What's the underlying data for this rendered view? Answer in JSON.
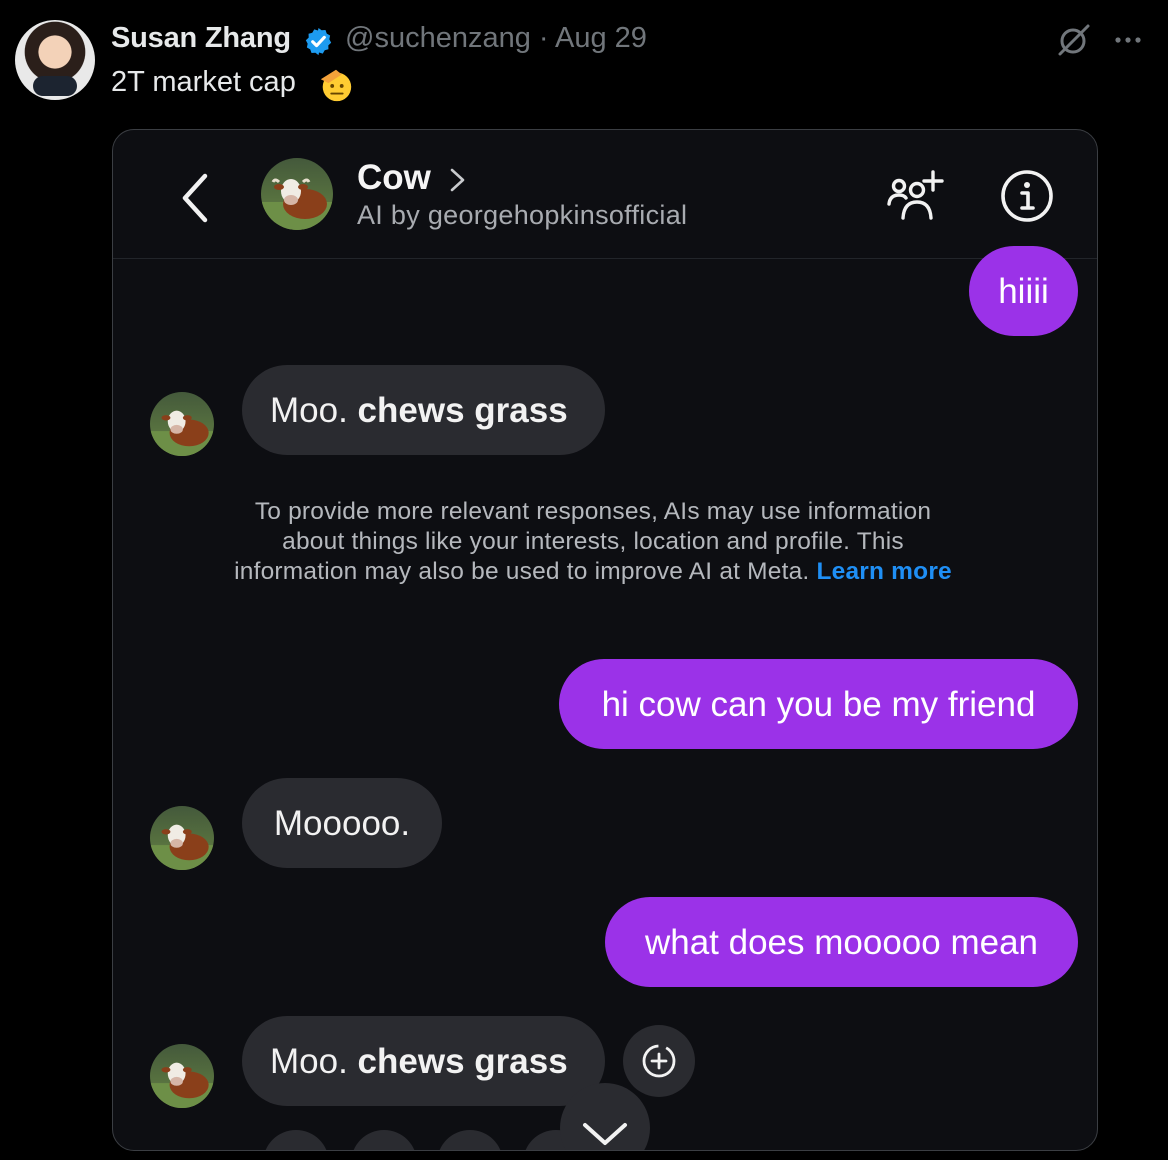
{
  "tweet": {
    "author_name": "Susan Zhang",
    "handle_and_date": "@suchenzang · Aug 29",
    "text": "2T market cap",
    "emoji": "saluting-face-emoji"
  },
  "chat": {
    "title": "Cow",
    "subtitle": "AI by georgehopkinsofficial",
    "messages": [
      {
        "from": "user",
        "text": "hiiii"
      },
      {
        "from": "cow",
        "plain": "Moo. ",
        "bold": "chews grass"
      },
      {
        "from": "user",
        "text": "hi cow can you be my friend"
      },
      {
        "from": "cow",
        "plain": "Mooooo.",
        "bold": ""
      },
      {
        "from": "user",
        "text": "what does mooooo mean"
      },
      {
        "from": "cow",
        "plain": "Moo. ",
        "bold": "chews grass"
      }
    ],
    "notice": {
      "text": "To provide more relevant responses, AIs may use information about things like your interests, location and profile. This information may also be used to improve AI at Meta.",
      "link": "Learn more"
    }
  },
  "colors": {
    "outgoing_bubble": "#9b32e8",
    "incoming_bubble": "#2a2b30",
    "link": "#1f8ff5",
    "verified": "#1d9bf0"
  }
}
